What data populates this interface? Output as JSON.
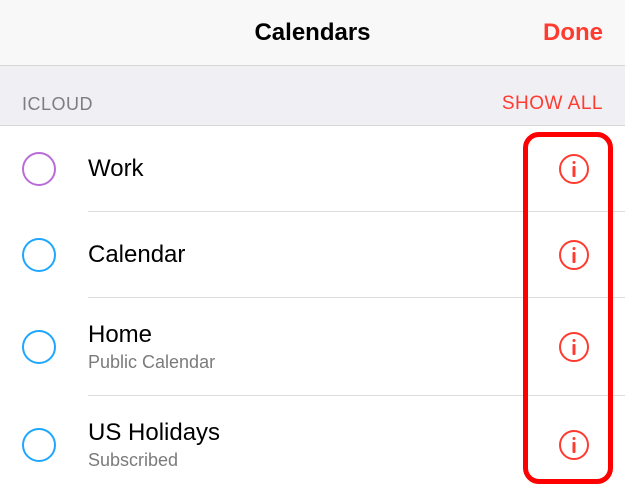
{
  "navbar": {
    "title": "Calendars",
    "done": "Done"
  },
  "section": {
    "label": "ICLOUD",
    "showAll": "SHOW ALL"
  },
  "calendars": [
    {
      "name": "Work",
      "sub": "",
      "color": "c-purple"
    },
    {
      "name": "Calendar",
      "sub": "",
      "color": "c-blue"
    },
    {
      "name": "Home",
      "sub": "Public Calendar",
      "color": "c-blue"
    },
    {
      "name": "US Holidays",
      "sub": "Subscribed",
      "color": "c-blue"
    }
  ]
}
